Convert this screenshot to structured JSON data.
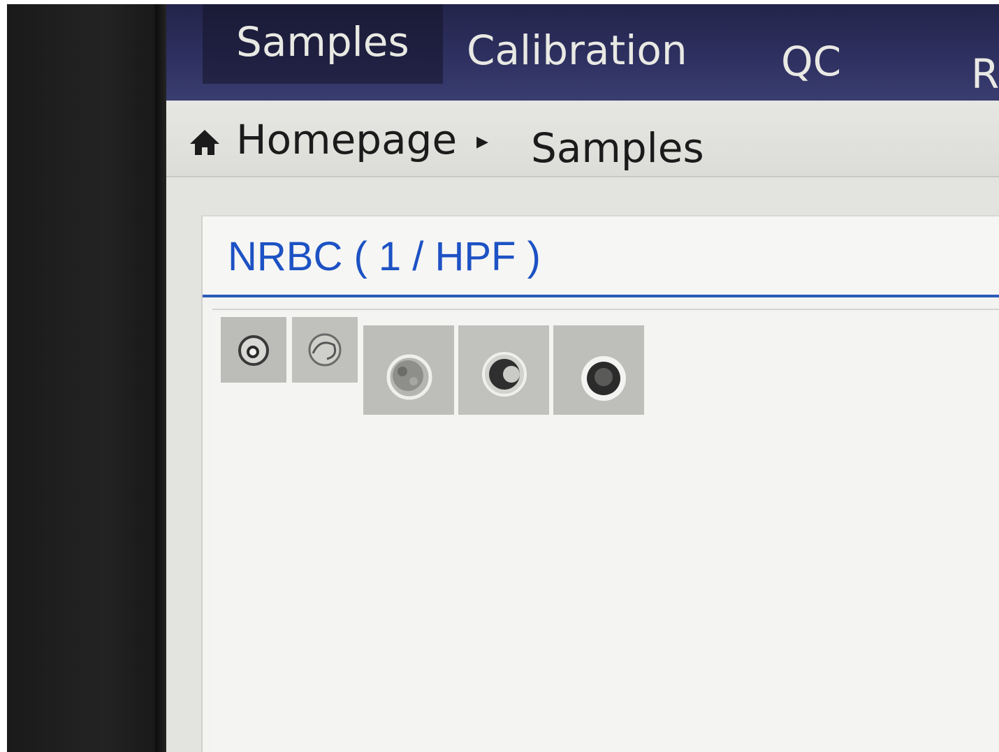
{
  "nav": {
    "tabs": [
      {
        "label": "Samples",
        "active": true
      },
      {
        "label": "Calibration",
        "active": false
      },
      {
        "label": "QC",
        "active": false
      },
      {
        "label": "R",
        "active": false
      }
    ]
  },
  "breadcrumb": {
    "home_label": "Homepage",
    "separator": "▸",
    "current_label": "Samples",
    "home_icon": "home-icon"
  },
  "panel": {
    "title": "NRBC ( 1 / HPF )",
    "accent_color": "#1d52c4"
  },
  "thumbnails": [
    {
      "name": "cell-image-1"
    },
    {
      "name": "cell-image-2"
    },
    {
      "name": "cell-image-3"
    },
    {
      "name": "cell-image-4"
    },
    {
      "name": "cell-image-5"
    }
  ]
}
